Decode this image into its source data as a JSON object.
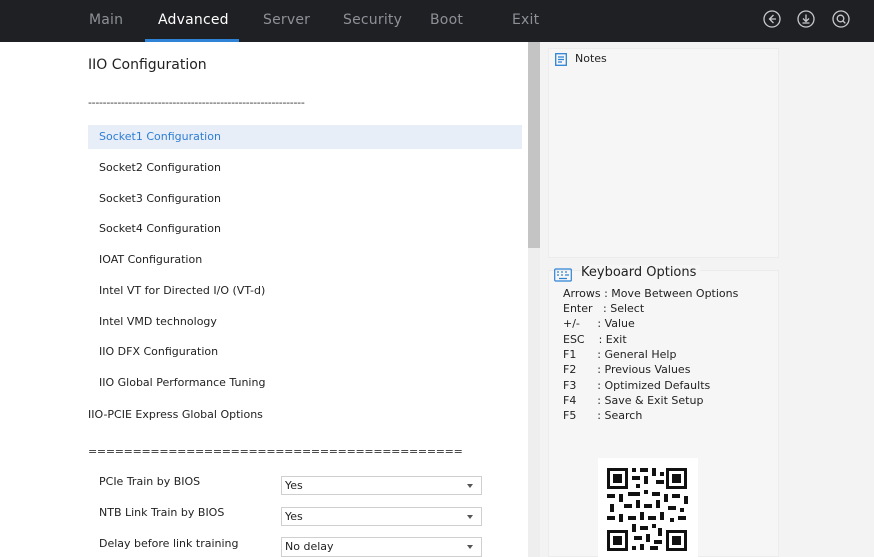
{
  "tabs": [
    {
      "label": "Main"
    },
    {
      "label": "Advanced"
    },
    {
      "label": "Server"
    },
    {
      "label": "Security"
    },
    {
      "label": "Boot"
    },
    {
      "label": "Exit"
    }
  ],
  "active_tab": "Advanced",
  "top_icons": [
    "back-icon",
    "save-icon",
    "search-icon"
  ],
  "page": {
    "title": "IIO Configuration",
    "separator1": "-----------------------------------------------------------",
    "menu": [
      {
        "label": "Socket1 Configuration"
      },
      {
        "label": "Socket2 Configuration"
      },
      {
        "label": "Socket3 Configuration"
      },
      {
        "label": "Socket4 Configuration"
      },
      {
        "label": "IOAT Configuration"
      },
      {
        "label": "Intel VT for Directed I/O (VT-d)"
      },
      {
        "label": "Intel VMD technology"
      },
      {
        "label": "IIO DFX Configuration"
      },
      {
        "label": "IIO Global Performance Tuning"
      }
    ],
    "section_label": "IIO-PCIE Express Global Options",
    "separator2": "==========================================",
    "options": [
      {
        "label": "PCIe Train by BIOS",
        "value": "Yes"
      },
      {
        "label": "NTB Link Train by BIOS",
        "value": "Yes"
      },
      {
        "label": "Delay before link training",
        "value": "No delay"
      }
    ]
  },
  "notes": {
    "title": "Notes"
  },
  "keyboard": {
    "title": "Keyboard Options",
    "lines": [
      "Arrows : Move Between Options",
      "Enter   : Select",
      "+/-     : Value",
      "ESC    : Exit",
      "F1      : General Help",
      "F2      : Previous Values",
      "F3      : Optimized Defaults",
      "F4      : Save & Exit Setup",
      "F5      : Search"
    ]
  },
  "colors": {
    "topbar": "#1f2024",
    "accent": "#2e83d6",
    "selected_bg": "#e8eef7",
    "selected_text": "#2e7dd4"
  }
}
